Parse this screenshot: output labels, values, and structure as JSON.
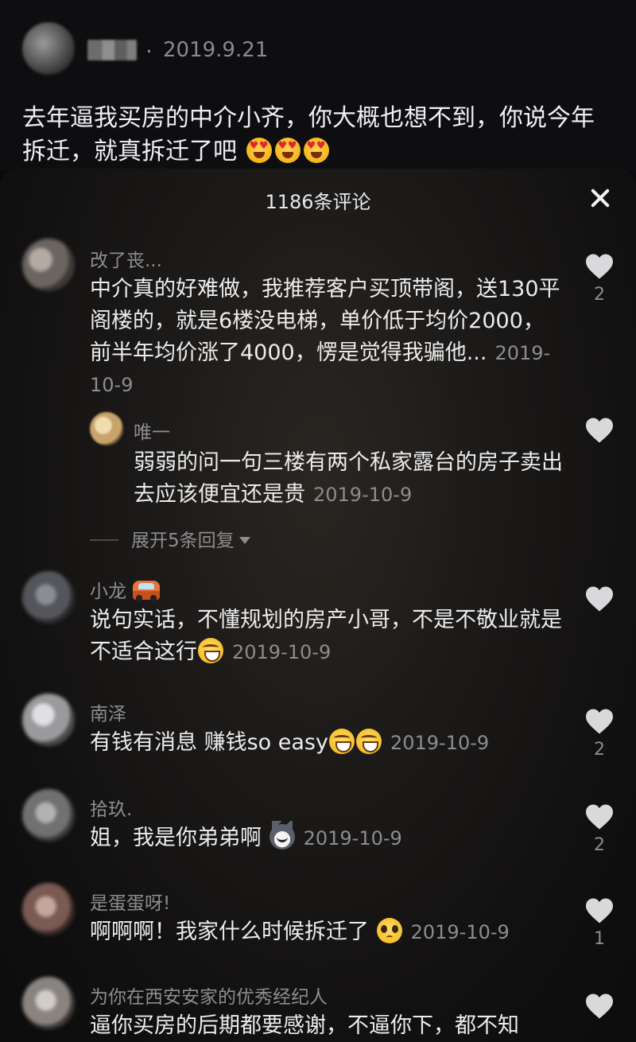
{
  "post": {
    "date": "2019.9.21",
    "dot": "·",
    "text": "去年逼我买房的中介小齐，你大概也想不到，你说今年拆迁，就真拆迁了吧"
  },
  "sheet": {
    "title": "1186条评论"
  },
  "comments": [
    {
      "name": "改了丧...",
      "text": "中介真的好难做，我推荐客户买顶带阁，送130平阁楼的，就是6楼没电梯，单价低于均价2000，前半年均价涨了4000，愣是觉得我骗他...",
      "date": "2019-10-9",
      "likes": "2",
      "avatar_color": "#6b6560"
    },
    {
      "name": "唯一",
      "text": "弱弱的问一句三楼有两个私家露台的房子卖出去应该便宜还是贵",
      "date": "2019-10-9",
      "likes": "",
      "avatar_color": "#c9a46a"
    },
    {
      "name": "小龙",
      "text": "说句实话，不懂规划的房产小哥，不是不敬业就是不适合这行",
      "date": "2019-10-9",
      "likes": "",
      "avatar_color": "#55565c"
    },
    {
      "name": "南泽",
      "text": "有钱有消息 赚钱so easy",
      "date": "2019-10-9",
      "likes": "2",
      "avatar_color": "#9a9a9c"
    },
    {
      "name": "拾玖.",
      "text": "姐，我是你弟弟啊",
      "date": "2019-10-9",
      "likes": "2",
      "avatar_color": "#717171"
    },
    {
      "name": "是蛋蛋呀!",
      "text": "啊啊啊！我家什么时候拆迁了",
      "date": "2019-10-9",
      "likes": "1",
      "avatar_color": "#7a5a52"
    },
    {
      "name": "为你在西安安家的优秀经纪人",
      "text": "逼你买房的后期都要感谢，不逼你下，都不知",
      "date": "",
      "likes": "",
      "avatar_color": "#8a8480"
    }
  ],
  "expand_replies": {
    "label": "展开5条回复"
  },
  "icons": {
    "close": "close-icon",
    "heart": "heart-icon",
    "emoji_heart_eyes": "heart-eyes-emoji",
    "emoji_laugh": "laughing-emoji",
    "emoji_car": "car-emoji",
    "emoji_husky": "husky-emoji",
    "emoji_plead": "pleading-emoji",
    "expand_arrow": "triangle-down-icon"
  },
  "colors": {
    "background": "#0b0b0d",
    "text_primary": "#ececee",
    "text_secondary": "#8d8c8f",
    "heart_fill": "#d9d9db"
  }
}
